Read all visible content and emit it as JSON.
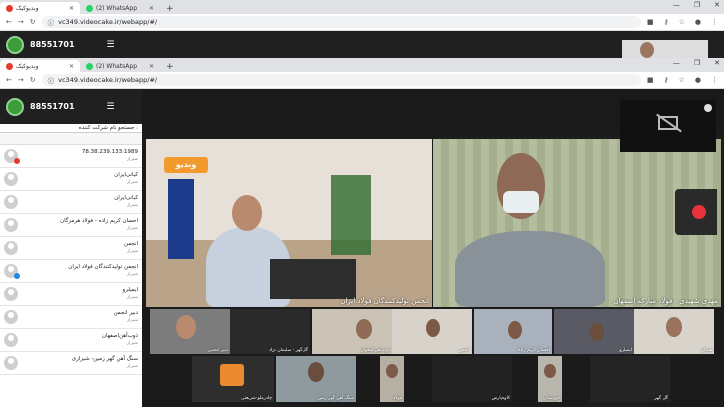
{
  "browser": {
    "tabs": [
      {
        "title": "وبدیوکیک",
        "active": true,
        "fav_color": "#e23a2d"
      },
      {
        "title": "(2) WhatsApp",
        "active": false,
        "fav_color": "#25d366"
      }
    ],
    "url": "vc349.videocake.ir/webapp/#/"
  },
  "app": {
    "number": "88551701"
  },
  "sidebar": {
    "header": "جستجو نام شرکت کننده :",
    "participants": [
      {
        "name": "78.38.239.133:1989",
        "city": "شیراز",
        "badge": "#e23a2d"
      },
      {
        "name": "کیانی‌ایران",
        "city": "شیراز",
        "badge": ""
      },
      {
        "name": "کیانی‌ایران",
        "city": "شیراز",
        "badge": ""
      },
      {
        "name": "احسان کریم زاده - فولاد هرمزگان",
        "city": "شیراز",
        "badge": ""
      },
      {
        "name": "انجمن",
        "city": "شیراز",
        "badge": ""
      },
      {
        "name": "انجمن تولیدکنندگان فولاد ایران",
        "city": "شیراز",
        "badge": "#1e88e5"
      },
      {
        "name": "ایمیلرو",
        "city": "شیراز",
        "badge": ""
      },
      {
        "name": "دبیر انجمن",
        "city": "شیراز",
        "badge": ""
      },
      {
        "name": "ذوب‌آهن‌اصفهان",
        "city": "شیراز",
        "badge": ""
      },
      {
        "name": "سنگ آهن گهر زمین- شیرازی",
        "city": "شیراز",
        "badge": ""
      }
    ]
  },
  "main_videos": [
    {
      "label": "انجمن تولیدکنندگان فولاد ایران",
      "logo": "وبدیو"
    },
    {
      "label": "مهدی شهیدی - فولاد مبارکه اصفهان"
    }
  ],
  "thumbs": [
    {
      "label": "دبیر انجمن"
    },
    {
      "label": "گل‌گهر - سلیمان نژاد"
    },
    {
      "label": "ذوب‌آهن‌اصفهان"
    },
    {
      "label": "انجمن"
    },
    {
      "label": "احسان کریم زاده"
    },
    {
      "label": "ایمیلرو"
    },
    {
      "label": "هیدکو"
    },
    {
      "label": "چادرملو-شریعتی"
    },
    {
      "label": "سنگ آهن گهر زمین"
    },
    {
      "label": "فولاد"
    },
    {
      "label": "کاوه‌پارس"
    },
    {
      "label": "خوزستان"
    },
    {
      "label": "گل گهر"
    }
  ]
}
